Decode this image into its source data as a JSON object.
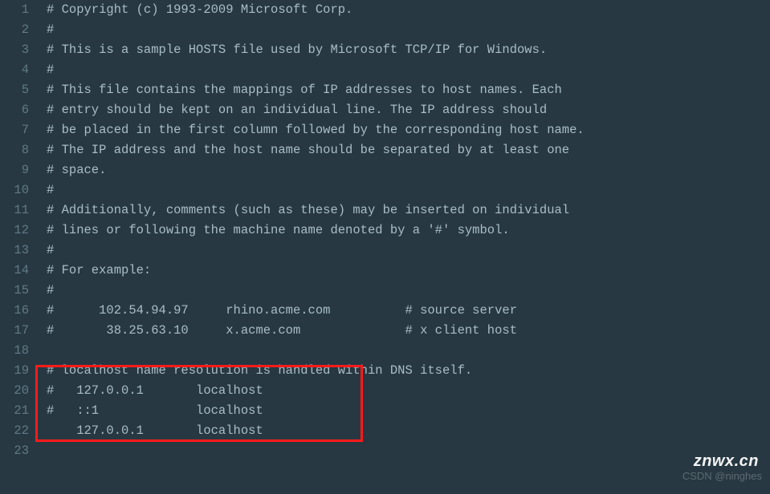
{
  "lines": [
    "# Copyright (c) 1993-2009 Microsoft Corp.",
    "#",
    "# This is a sample HOSTS file used by Microsoft TCP/IP for Windows.",
    "#",
    "# This file contains the mappings of IP addresses to host names. Each",
    "# entry should be kept on an individual line. The IP address should",
    "# be placed in the first column followed by the corresponding host name.",
    "# The IP address and the host name should be separated by at least one",
    "# space.",
    "#",
    "# Additionally, comments (such as these) may be inserted on individual",
    "# lines or following the machine name denoted by a '#' symbol.",
    "#",
    "# For example:",
    "#",
    "#      102.54.94.97     rhino.acme.com          # source server",
    "#       38.25.63.10     x.acme.com              # x client host",
    "",
    "# localhost name resolution is handled within DNS itself.",
    "#   127.0.0.1       localhost",
    "#   ::1             localhost",
    "    127.0.0.1       localhost",
    ""
  ],
  "watermarks": {
    "site": "znwx.cn",
    "author": "CSDN @ninghes"
  }
}
